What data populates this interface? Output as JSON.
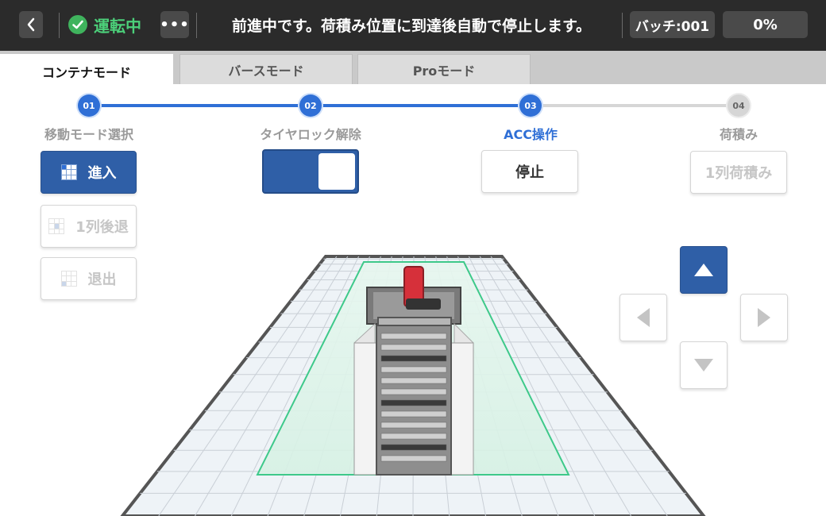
{
  "topbar": {
    "back_icon": "chevron-left-icon",
    "status_icon": "check-circle-icon",
    "status": "運転中",
    "more_label": "•••",
    "message": "前進中です。荷積み位置に到達後自動で停止します。",
    "batch": "バッチ:001",
    "progress": "0%",
    "progress_value": 0,
    "status_color": "#4cd07a"
  },
  "tabs": [
    {
      "label": "コンテナモード",
      "active": true
    },
    {
      "label": "バースモード",
      "active": false
    },
    {
      "label": "Proモード",
      "active": false
    }
  ],
  "steps": [
    {
      "number": "01",
      "label": "移動モード選択",
      "state": "done"
    },
    {
      "number": "02",
      "label": "タイヤロック解除",
      "state": "done"
    },
    {
      "number": "03",
      "label": "ACC操作",
      "state": "current"
    },
    {
      "number": "04",
      "label": "荷積み",
      "state": "todo"
    }
  ],
  "actions": {
    "enter": "進入",
    "back_one_row": "1列後退",
    "exit": "退出",
    "stop": "停止",
    "load_one_row": "1列荷積み"
  },
  "tire_lock_toggle": {
    "on": true
  },
  "dpad": {
    "up_icon": "arrow-up-icon",
    "left_icon": "arrow-left-icon",
    "right_icon": "arrow-right-icon",
    "down_icon": "arrow-down-icon"
  },
  "colors": {
    "accent": "#2f5fa7",
    "step_active": "#2f6fd6",
    "lane": "#3ec98a",
    "vehicle": "#d6303a"
  }
}
